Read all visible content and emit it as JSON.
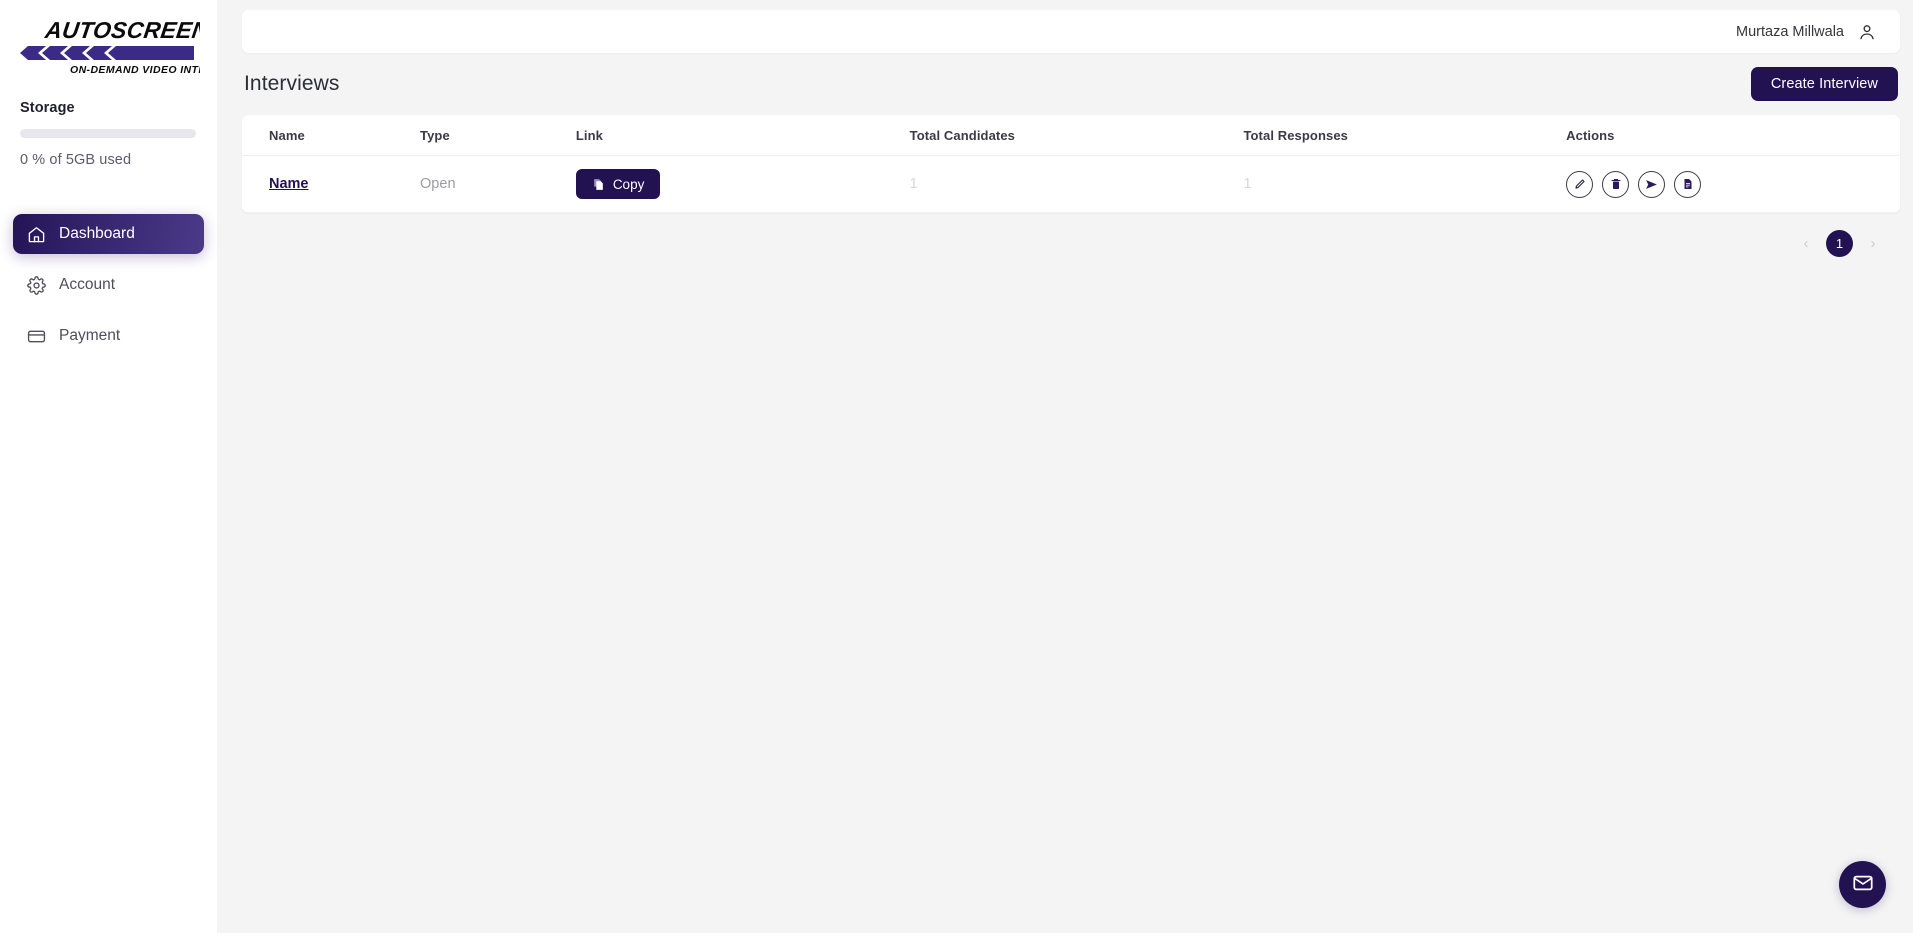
{
  "brand": {
    "logo_title": "AUTOSCREEN",
    "logo_tagline": "ON-DEMAND VIDEO INTERVIEWS",
    "accent_color": "#3a2a74",
    "primary_color": "#231252"
  },
  "sidebar": {
    "storage": {
      "label": "Storage",
      "usage_text": "0 % of 5GB used",
      "percent": 0
    },
    "items": [
      {
        "label": "Dashboard",
        "icon": "home-icon",
        "active": true
      },
      {
        "label": "Account",
        "icon": "gear-icon",
        "active": false
      },
      {
        "label": "Payment",
        "icon": "credit-card-icon",
        "active": false
      }
    ]
  },
  "topbar": {
    "user_name": "Murtaza Millwala",
    "user_icon": "person-icon"
  },
  "main": {
    "page_title": "Interviews",
    "create_button": "Create Interview",
    "table": {
      "headers": [
        "Name",
        "Type",
        "Link",
        "Total Candidates",
        "Total Responses",
        "Actions"
      ],
      "rows": [
        {
          "name": "Name",
          "type": "Open",
          "link_button": "Copy",
          "total_candidates": "1",
          "total_responses": "1",
          "actions": [
            "edit-icon",
            "delete-icon",
            "send-icon",
            "report-icon"
          ]
        }
      ]
    },
    "pagination": {
      "prev": "‹",
      "current_page": "1",
      "next": "›"
    }
  },
  "fab": {
    "icon": "mail-icon"
  }
}
